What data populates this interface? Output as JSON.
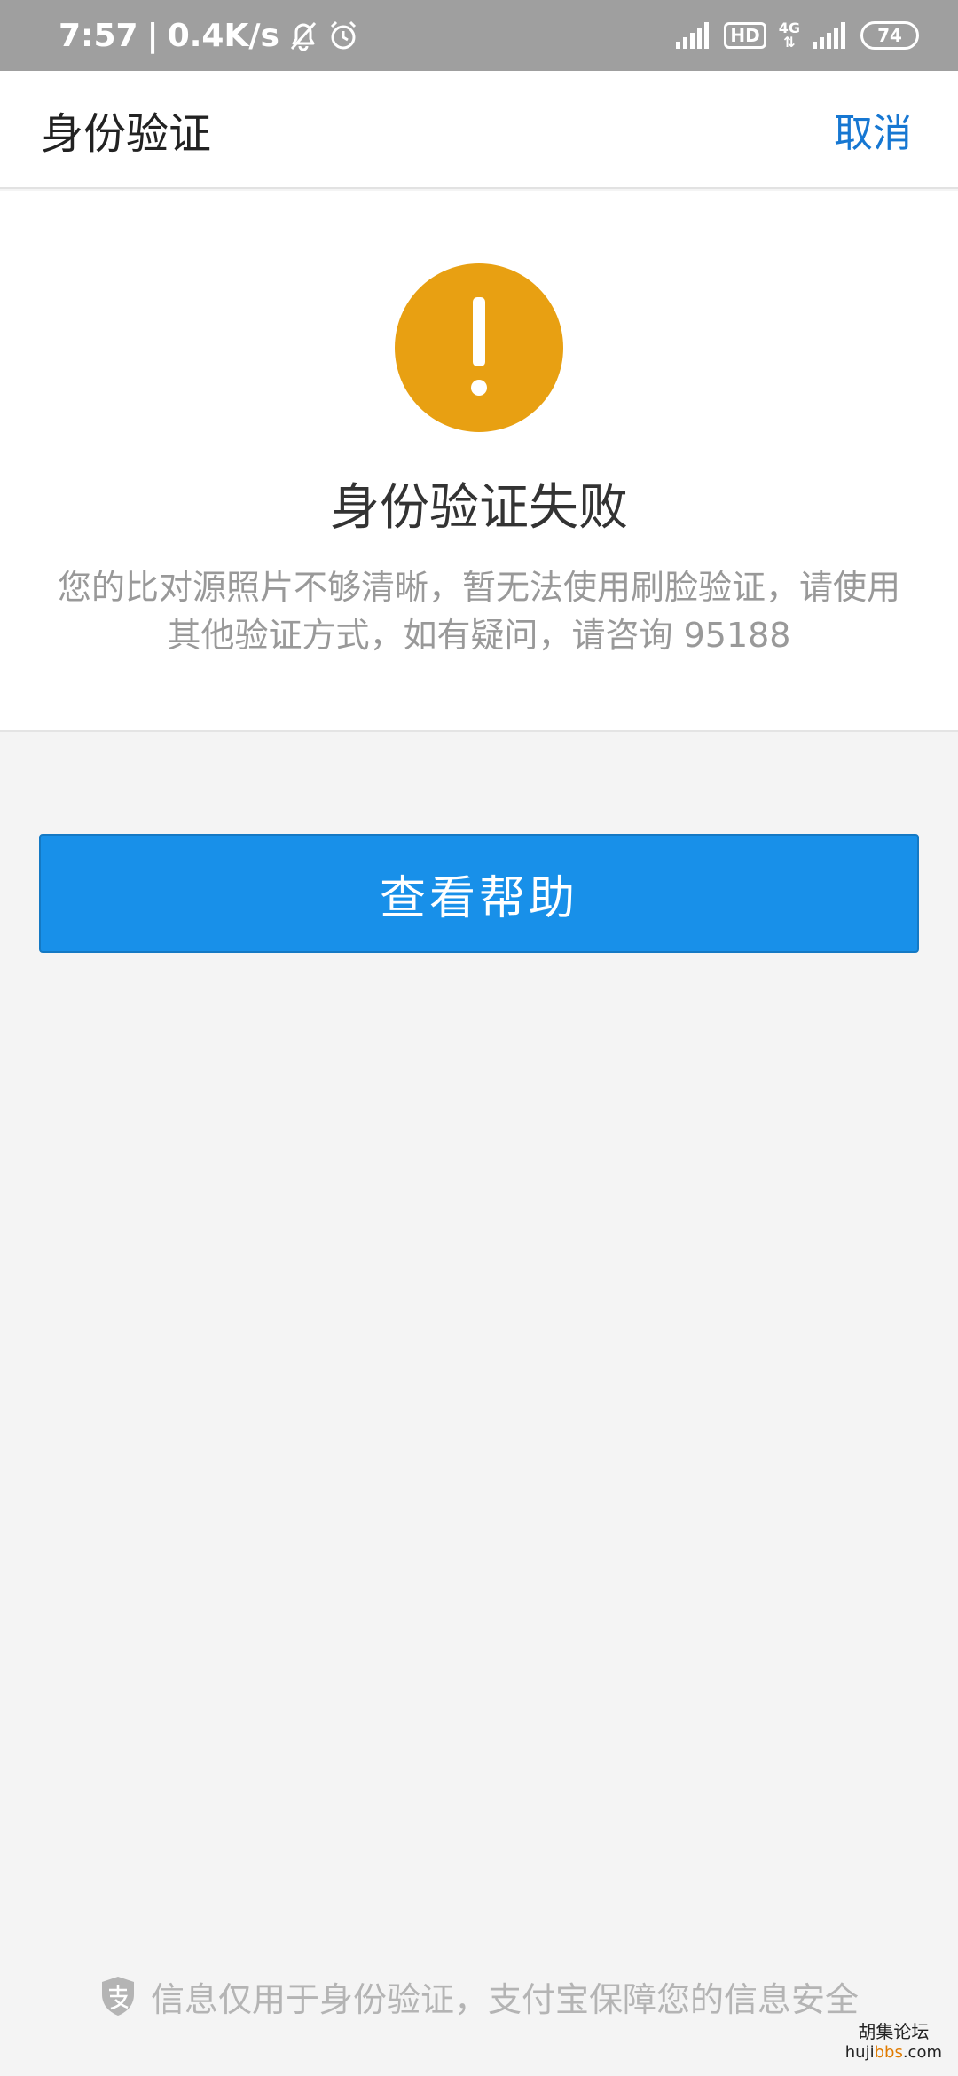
{
  "status_bar": {
    "time": "7:57",
    "separator": "|",
    "net_speed": "0.4K/s",
    "hd": "HD",
    "network_type": "4G",
    "battery": "74",
    "icons": [
      "bell-off-icon",
      "alarm-icon",
      "signal-icon",
      "hd-icon",
      "4g-signal-icon",
      "battery-icon"
    ]
  },
  "header": {
    "title": "身份验证",
    "cancel_label": "取消"
  },
  "result": {
    "icon": "warning-icon",
    "icon_color": "#e8a012",
    "title": "身份验证失败",
    "description_line1": "您的比对源照片不够清晰，暂无法使用刷脸验证，请使用",
    "description_line2": "其他验证方式，如有疑问，请咨询 95188"
  },
  "actions": {
    "help_label": "查看帮助",
    "help_color": "#1890e9"
  },
  "footer": {
    "icon": "alipay-shield-icon",
    "text": "信息仅用于身份验证，支付宝保障您的信息安全"
  },
  "watermark": {
    "name": "胡集论坛",
    "url_prefix": "huji",
    "url_accent": "bbs",
    "url_suffix": ".com"
  },
  "colors": {
    "status_bar": "#9f9f9f",
    "link": "#1677d2",
    "muted_text": "#999999",
    "page_bg": "#f4f4f4"
  }
}
